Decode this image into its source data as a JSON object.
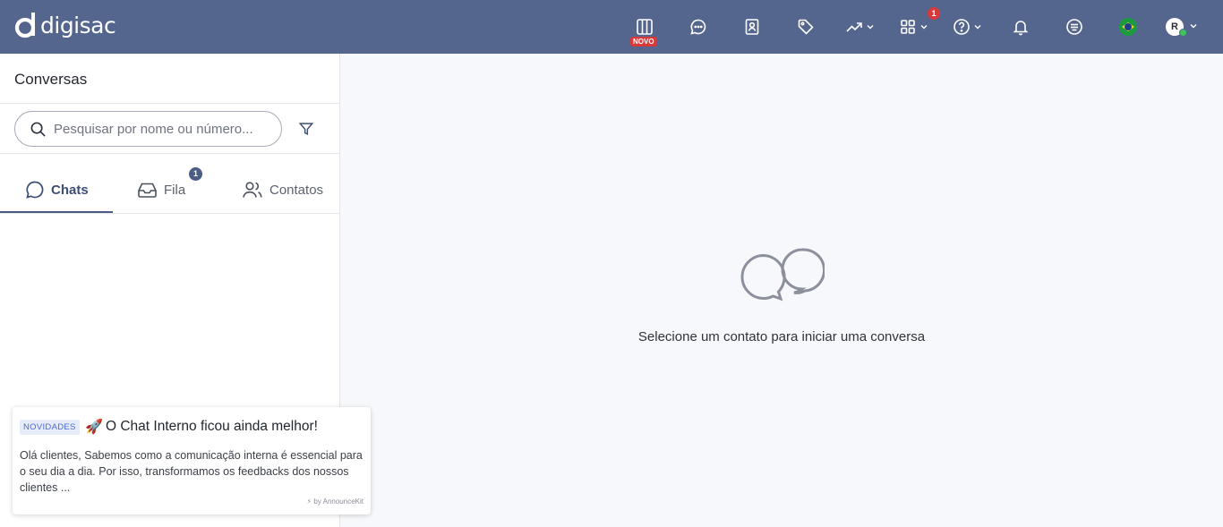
{
  "app": {
    "brand": "digisac"
  },
  "topbar": {
    "novo_badge": "NOVO",
    "apps_count": "1",
    "icons": [
      "kanban-icon",
      "chat-bubble-icon",
      "contacts-book-icon",
      "tag-icon",
      "trending-up-icon",
      "apps-grid-icon",
      "help-circle-icon",
      "bell-icon",
      "menu-list-icon"
    ],
    "language": "pt-BR",
    "avatar_letter": "R"
  },
  "sidebar": {
    "title": "Conversas",
    "search_placeholder": "Pesquisar por nome ou número...",
    "tabs": [
      {
        "label": "Chats",
        "active": true
      },
      {
        "label": "Fila",
        "badge": "1"
      },
      {
        "label": "Contatos"
      }
    ]
  },
  "main": {
    "empty_message": "Selecione um contato para iniciar uma conversa"
  },
  "announcement": {
    "tag": "NOVIDADES",
    "emoji": "🚀",
    "title": "O Chat Interno ficou ainda melhor!",
    "body": "Olá clientes, Sabemos como a comunicação interna é essencial para o seu dia a dia. Por isso, transformamos os feedbacks dos nossos clientes ...",
    "footer": "by AnnounceKit"
  },
  "colors": {
    "topbar": "#54658e",
    "badge": "#d83a3a",
    "accent": "#4c5d85"
  }
}
